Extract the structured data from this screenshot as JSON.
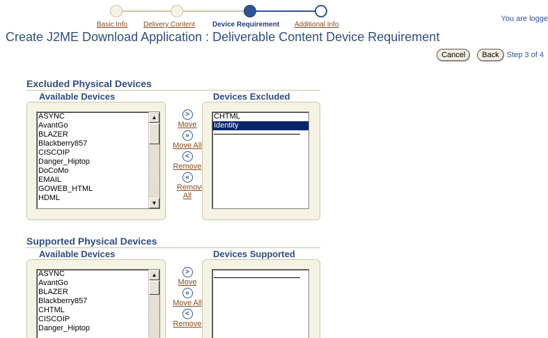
{
  "train": {
    "steps": [
      {
        "label": "Basic Info",
        "state": "visited"
      },
      {
        "label": "Delivery Content",
        "state": "visited"
      },
      {
        "label": "Device Requirement",
        "state": "current"
      },
      {
        "label": "Additional Info",
        "state": "next"
      }
    ]
  },
  "header": {
    "logged_in_text": "You are logge",
    "title": "Create J2ME Download Application : Deliverable Content Device Requirement"
  },
  "actions": {
    "cancel_label": "Cancel",
    "back_label": "Back",
    "step_text": "Step 3 of 4"
  },
  "excluded_section": {
    "header": "Excluded Physical Devices",
    "available_label": "Available Devices",
    "selected_label": "Devices Excluded",
    "available_items": [
      "ASYNC",
      "AvantGo",
      "BLAZER",
      "Blackberry857",
      "CISCOIP",
      "Danger_Hiptop",
      "DoCoMo",
      "EMAIL",
      "GOWEB_HTML",
      "HDML"
    ],
    "selected_items": [
      "CHTML",
      "Identity"
    ],
    "selected_highlight": "Identity",
    "shuttle": {
      "move": "Move",
      "move_all": "Move All",
      "remove": "Remove",
      "remove_all": "Remove All"
    }
  },
  "supported_section": {
    "header": "Supported Physical Devices",
    "available_label": "Available Devices",
    "selected_label": "Devices Supported",
    "available_items": [
      "ASYNC",
      "AvantGo",
      "BLAZER",
      "Blackberry857",
      "CHTML",
      "CISCOIP",
      "Danger_Hiptop"
    ],
    "selected_items": [],
    "shuttle": {
      "move": "Move",
      "move_all": "Move All",
      "remove": "Remove"
    }
  },
  "icons": {
    "move": "move-right-icon",
    "move_all": "move-all-right-icon",
    "remove": "remove-left-icon",
    "remove_all": "remove-all-left-icon",
    "scroll_up": "scroll-up-arrow-icon",
    "scroll_down": "scroll-down-arrow-icon"
  },
  "colors": {
    "accent": "#2f5496",
    "title": "#2f4d7f",
    "link": "#8a4b19",
    "panel_bg": "#f5f3e4",
    "selection": "#0a246a"
  }
}
